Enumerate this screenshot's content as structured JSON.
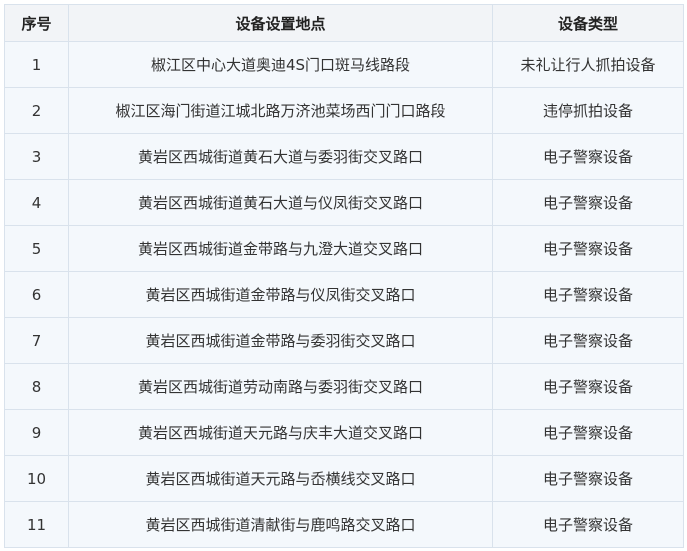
{
  "table": {
    "headers": [
      "序号",
      "设备设置地点",
      "设备类型"
    ],
    "rows": [
      [
        "1",
        "椒江区中心大道奥迪4S门口斑马线路段",
        "未礼让行人抓拍设备"
      ],
      [
        "2",
        "椒江区海门街道江城北路万济池菜场西门门口路段",
        "违停抓拍设备"
      ],
      [
        "3",
        "黄岩区西城街道黄石大道与委羽街交叉路口",
        "电子警察设备"
      ],
      [
        "4",
        "黄岩区西城街道黄石大道与仪凤街交叉路口",
        "电子警察设备"
      ],
      [
        "5",
        "黄岩区西城街道金带路与九澄大道交叉路口",
        "电子警察设备"
      ],
      [
        "6",
        "黄岩区西城街道金带路与仪凤街交叉路口",
        "电子警察设备"
      ],
      [
        "7",
        "黄岩区西城街道金带路与委羽街交叉路口",
        "电子警察设备"
      ],
      [
        "8",
        "黄岩区西城街道劳动南路与委羽街交叉路口",
        "电子警察设备"
      ],
      [
        "9",
        "黄岩区西城街道天元路与庆丰大道交叉路口",
        "电子警察设备"
      ],
      [
        "10",
        "黄岩区西城街道天元路与岙横线交叉路口",
        "电子警察设备"
      ],
      [
        "11",
        "黄岩区西城街道清献街与鹿鸣路交叉路口",
        "电子警察设备"
      ]
    ]
  }
}
